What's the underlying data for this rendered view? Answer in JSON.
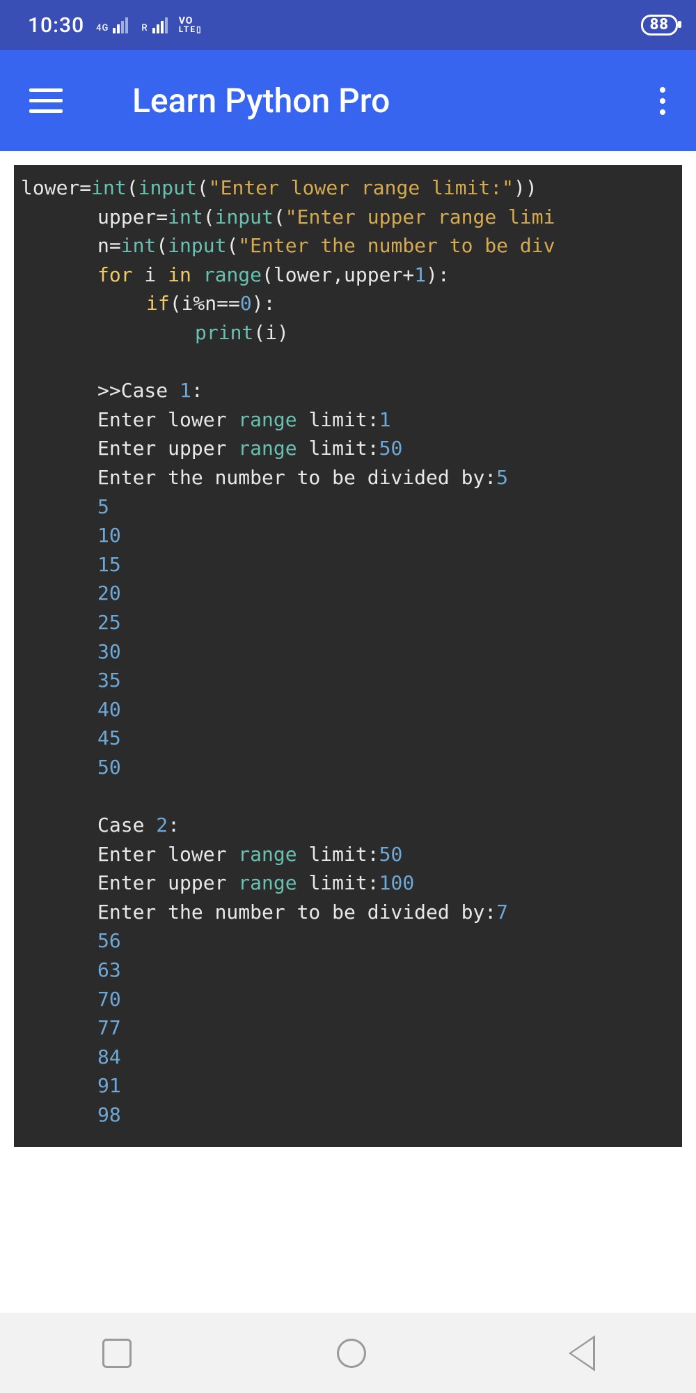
{
  "status": {
    "time": "10:30",
    "net1": "4G",
    "net2": "R",
    "volte_top": "VO",
    "volte_bot": "LTE▯",
    "battery": "88"
  },
  "appbar": {
    "title": "Learn Python Pro"
  },
  "code": {
    "l1": {
      "a": "lower",
      "eq": "=",
      "fn": "int",
      "p1": "(",
      "fn2": "input",
      "p2": "(",
      "s": "\"Enter lower range limit:\"",
      "p3": ")",
      "p4": ")"
    },
    "l2": {
      "a": "upper",
      "eq": "=",
      "fn": "int",
      "p1": "(",
      "fn2": "input",
      "p2": "(",
      "s": "\"Enter upper range limi"
    },
    "l3": {
      "a": "n",
      "eq": "=",
      "fn": "int",
      "p1": "(",
      "fn2": "input",
      "p2": "(",
      "s": "\"Enter the number to be div"
    },
    "l4": {
      "kfor": "for",
      "i": " i ",
      "kin": "in",
      "sp": " ",
      "fn": "range",
      "args": "(lower,upper+",
      "one": "1",
      "end": "):"
    },
    "l5": {
      "kif": "if",
      "cond": "(i%n==",
      "zero": "0",
      "end": "):"
    },
    "l6": {
      "fn": "print",
      "args": "(i)"
    },
    "case1_head": {
      "pre": ">>Case ",
      "n": "1",
      "colon": ":"
    },
    "case1_lower": {
      "a": "Enter lower ",
      "r": "range",
      "b": " limit:",
      "v": "1"
    },
    "case1_upper": {
      "a": "Enter upper ",
      "r": "range",
      "b": " limit:",
      "v": "50"
    },
    "case1_div": {
      "a": "Enter the number to be divided by:",
      "v": "5"
    },
    "case1_out": [
      "5",
      "10",
      "15",
      "20",
      "25",
      "30",
      "35",
      "40",
      "45",
      "50"
    ],
    "case2_head": {
      "pre": "Case ",
      "n": "2",
      "colon": ":"
    },
    "case2_lower": {
      "a": "Enter lower ",
      "r": "range",
      "b": " limit:",
      "v": "50"
    },
    "case2_upper": {
      "a": "Enter upper ",
      "r": "range",
      "b": " limit:",
      "v": "100"
    },
    "case2_div": {
      "a": "Enter the number to be divided by:",
      "v": "7"
    },
    "case2_out": [
      "56",
      "63",
      "70",
      "77",
      "84",
      "91",
      "98"
    ]
  }
}
